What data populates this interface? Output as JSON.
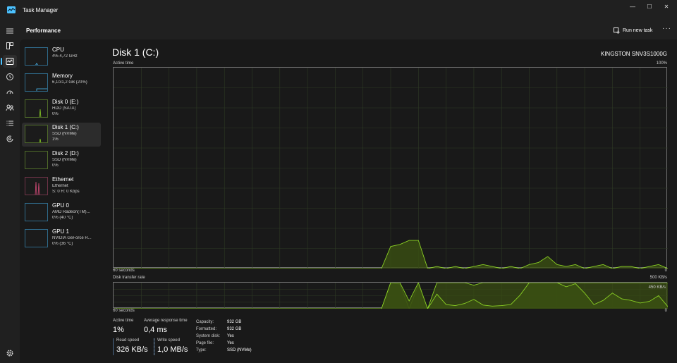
{
  "window": {
    "title": "Task Manager",
    "minimize_glyph": "—",
    "maximize_glyph": "☐",
    "close_glyph": "✕"
  },
  "nav": {
    "icons": [
      "hamburger-icon",
      "processes-icon",
      "performance-icon",
      "app-history-icon",
      "startup-apps-icon",
      "users-icon",
      "details-icon",
      "services-icon"
    ],
    "settings_icon": "gear-icon"
  },
  "header": {
    "title": "Performance",
    "run_new_task": "Run new task",
    "more": "···"
  },
  "devices": [
    {
      "name": "CPU",
      "line1": "4% 4,72 GHz",
      "line2": "",
      "color": "#4cc2ff"
    },
    {
      "name": "Memory",
      "line1": "6,1/31,2 GB (20%)",
      "line2": "",
      "color": "#4cc2ff"
    },
    {
      "name": "Disk 0 (E:)",
      "line1": "HDD (SATA)",
      "line2": "0%",
      "color": "#8ad024"
    },
    {
      "name": "Disk 1 (C:)",
      "line1": "SSD (NVMe)",
      "line2": "1%",
      "color": "#8ad024"
    },
    {
      "name": "Disk 2 (D:)",
      "line1": "SSD (NVMe)",
      "line2": "0%",
      "color": "#8ad024"
    },
    {
      "name": "Ethernet",
      "line1": "Ethernet",
      "line2": "S: 0 R: 0 Kbps",
      "color": "#d34a78"
    },
    {
      "name": "GPU 0",
      "line1": "AMD Radeon(TM)...",
      "line2": "0% (40 °C)",
      "color": "#4cc2ff"
    },
    {
      "name": "GPU 1",
      "line1": "NVIDIA GeForce R...",
      "line2": "0% (36 °C)",
      "color": "#4cc2ff"
    }
  ],
  "detail": {
    "title": "Disk 1 (C:)",
    "model": "KINGSTON SNV3S1000G",
    "active_time_label": "Active time",
    "active_time_max": "100%",
    "active_axis_left": "60 seconds",
    "active_axis_right": "0",
    "transfer_label": "Disk transfer rate",
    "transfer_max": "500 KB/s",
    "transfer_mark": "450 KB/s",
    "transfer_axis_left": "60 seconds",
    "transfer_axis_right": "0"
  },
  "stats": {
    "active_time": {
      "label": "Active time",
      "value": "1%"
    },
    "avg_response": {
      "label": "Average response time",
      "value": "0,4 ms"
    },
    "read_speed": {
      "label": "Read speed",
      "value": "326 KB/s"
    },
    "write_speed": {
      "label": "Write speed",
      "value": "1,0 MB/s"
    }
  },
  "properties": [
    {
      "label": "Capacity:",
      "value": "932 GB"
    },
    {
      "label": "Formatted:",
      "value": "932 GB"
    },
    {
      "label": "System disk:",
      "value": "Yes"
    },
    {
      "label": "Page file:",
      "value": "Yes"
    },
    {
      "label": "Type:",
      "value": "SSD (NVMe)"
    }
  ],
  "colors": {
    "accent": "#4cc2ff",
    "disk_line": "#8ad024",
    "disk_fill": "#3a4f12",
    "grid": "#2e3a24"
  },
  "chart_data": [
    {
      "type": "area",
      "title": "Active time",
      "xlabel": "60 seconds",
      "ylim": [
        0,
        100
      ],
      "x": [
        60,
        59,
        58,
        57,
        56,
        55,
        54,
        53,
        52,
        51,
        50,
        49,
        48,
        47,
        46,
        45,
        44,
        43,
        42,
        41,
        40,
        39,
        38,
        37,
        36,
        35,
        34,
        33,
        32,
        31,
        30,
        29,
        28,
        27,
        26,
        25,
        24,
        23,
        22,
        21,
        20,
        19,
        18,
        17,
        16,
        15,
        14,
        13,
        12,
        11,
        10,
        9,
        8,
        7,
        6,
        5,
        4,
        3,
        2,
        1,
        0
      ],
      "values": [
        0,
        0,
        0,
        0,
        0,
        0,
        0,
        0,
        0,
        0,
        0,
        0,
        0,
        0,
        0,
        0,
        0,
        0,
        0,
        0,
        0,
        0,
        0,
        0,
        0,
        0,
        0,
        0,
        0,
        0,
        11,
        12,
        14,
        14,
        0,
        1,
        0,
        1,
        0,
        1,
        2,
        1,
        0,
        1,
        0,
        2,
        3,
        6,
        2,
        1,
        2,
        0,
        1,
        2,
        0,
        1,
        1,
        0,
        1,
        2,
        0
      ]
    },
    {
      "type": "area",
      "title": "Disk transfer rate",
      "xlabel": "60 seconds",
      "ylim": [
        0,
        500
      ],
      "series": [
        {
          "name": "Read speed",
          "values": [
            0,
            0,
            0,
            0,
            0,
            0,
            0,
            0,
            0,
            0,
            0,
            0,
            0,
            0,
            0,
            0,
            0,
            0,
            0,
            0,
            0,
            0,
            0,
            0,
            0,
            0,
            0,
            0,
            0,
            0,
            500,
            500,
            150,
            500,
            0,
            280,
            80,
            60,
            100,
            180,
            70,
            50,
            60,
            80,
            260,
            500,
            500,
            500,
            500,
            420,
            480,
            300,
            80,
            160,
            300,
            190,
            160,
            110,
            140,
            250,
            40
          ]
        },
        {
          "name": "Write speed",
          "values": [
            0,
            0,
            0,
            0,
            0,
            0,
            0,
            0,
            0,
            0,
            0,
            0,
            0,
            0,
            0,
            0,
            0,
            0,
            0,
            0,
            0,
            0,
            0,
            0,
            0,
            0,
            0,
            0,
            0,
            0,
            500,
            470,
            0,
            460,
            0,
            500,
            500,
            500,
            500,
            450,
            500,
            500,
            500,
            500,
            500,
            500,
            500,
            500,
            500,
            500,
            500,
            500,
            500,
            500,
            500,
            500,
            500,
            500,
            500,
            500,
            500
          ]
        }
      ]
    }
  ]
}
